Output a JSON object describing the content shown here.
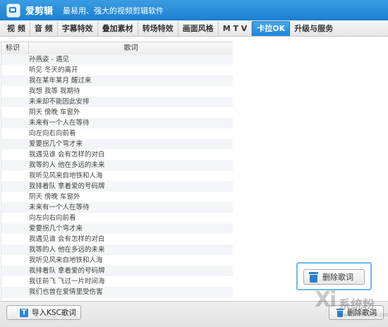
{
  "app": {
    "title": "爱剪辑",
    "slogan": "最易用、强大的视频剪辑软件"
  },
  "tabs": [
    {
      "label": "视  频"
    },
    {
      "label": "音  频"
    },
    {
      "label": "字幕特效"
    },
    {
      "label": "叠加素材"
    },
    {
      "label": "转场特效"
    },
    {
      "label": "画面风格"
    },
    {
      "label": "M T V"
    },
    {
      "label": "卡拉OK",
      "active": true
    },
    {
      "label": "升级与服务"
    }
  ],
  "table": {
    "col_mark": "标识",
    "col_lyric": "歌词"
  },
  "lyrics": [
    "孙燕姿 - 遇见",
    "听见 冬天的离开",
    "我在某年某月 醒过来",
    "我想 我等 我期待",
    "未来却不能因此安排",
    "阴天 傍晚 车窗外",
    "未来有一个人在等待",
    "向左向右向前看",
    "爱要拐几个弯才来",
    "我遇见谁 会有怎样的对白",
    "我等的人 他在多远的未来",
    "我听见风来自地铁和人海",
    "我排着队 拿着爱的号码牌",
    "阴天 傍晚 车窗外",
    "未来有一个人在等待",
    "向左向右向前看",
    "爱要拐几个弯才来",
    "我遇见谁 会有怎样的对白",
    "我等的人 他在多远的未来",
    "我听见风来自地铁和人海",
    "我排着队 拿着爱的号码牌",
    "我往前飞 飞过一片时间海",
    "我们也曾在爱情里受伤害"
  ],
  "buttons": {
    "import_label": "导入KSC歌词",
    "delete_label": "删除歌词",
    "callout_delete_label": "删除歌词"
  },
  "colors": {
    "title_bar": "#1c7fd0",
    "active_tab": "#1f86d6",
    "icon_blue": "#2a80cc",
    "callout_border": "#6eb8f0"
  },
  "watermark": {
    "text": "系统粉",
    "url": "www.win7999.com"
  }
}
